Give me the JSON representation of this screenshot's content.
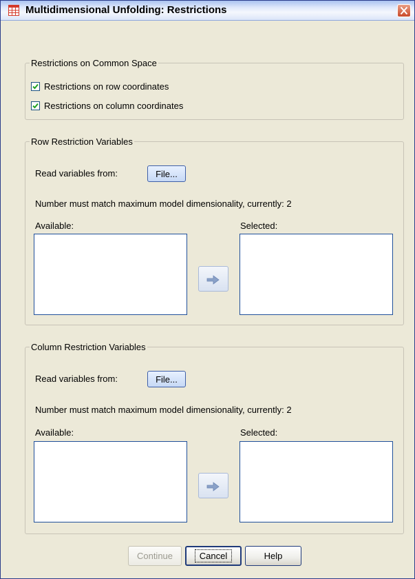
{
  "window": {
    "title": "Multidimensional Unfolding: Restrictions"
  },
  "common_space": {
    "legend": "Restrictions on Common Space",
    "row_label": "Restrictions on row coordinates",
    "row_checked": true,
    "column_label": "Restrictions on column coordinates",
    "column_checked": true
  },
  "row_restriction": {
    "legend": "Row Restriction Variables",
    "read_from": "Read variables from:",
    "file_button": "File...",
    "note": "Number must match maximum model dimensionality, currently:  2",
    "available_label": "Available:",
    "selected_label": "Selected:",
    "available_items": [],
    "selected_items": []
  },
  "column_restriction": {
    "legend": "Column Restriction Variables",
    "read_from": "Read variables from:",
    "file_button": "File...",
    "note": "Number must match maximum model dimensionality, currently:  2",
    "available_label": "Available:",
    "selected_label": "Selected:",
    "available_items": [],
    "selected_items": []
  },
  "buttons": {
    "continue": "Continue",
    "cancel": "Cancel",
    "help": "Help"
  },
  "colors": {
    "dialog_bg": "#ece9d8",
    "title_bar": "#dfe8fb",
    "close_button": "#c94a2a",
    "listbox_border": "#1f4f9a"
  },
  "icons": {
    "app": "spss-grid-icon",
    "close": "close-icon",
    "move": "right-arrow-icon"
  }
}
